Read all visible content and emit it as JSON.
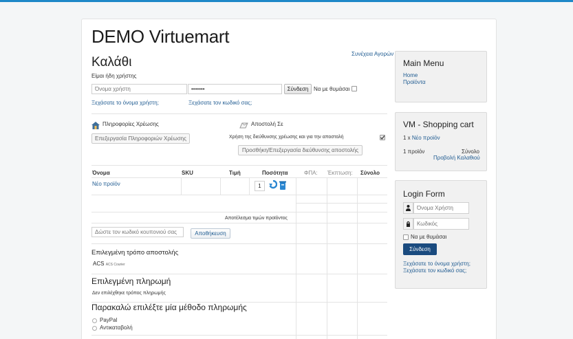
{
  "site": {
    "title": "DEMO Virtuemart"
  },
  "cart": {
    "heading": "Καλάθι",
    "continue_link": "Συνέχεια Αγορών",
    "already_user": "Είμαι ήδη χρήστης",
    "username_placeholder": "Όνομα χρήστη",
    "password_value": "•••••••",
    "login_button": "Σύνδεση",
    "remember_label": "Να με θυμάσαι",
    "forgot_username": "Ξεχάσατε το όνομα χρήστη;",
    "forgot_password": "Ξεχάσατε τον κωδικό σας;",
    "billing_title": "Πληροφορίες Χρέωσης",
    "billing_edit_button": "Επεξεργασία Πληροφοριών Χρέωσης",
    "shipping_title": "Αποστολή Σε",
    "use_billing_for_shipping": "Χρήση της διεύθυνσης χρέωσης και για την αποστολή",
    "shipping_edit_button": "Προσθήκη/Επεξεργασία διεύθυνσης αποστολής",
    "table": {
      "headers": [
        "Όνομα",
        "SKU",
        "Τιμή",
        "Ποσότητα",
        "ΦΠΑ:",
        "Έκπτωση:",
        "Σύνολο"
      ],
      "rows": [
        {
          "name": "Νέο προϊόν",
          "sku": "",
          "price": "",
          "quantity": "1",
          "tax": "",
          "discount": "",
          "total": ""
        }
      ],
      "products_result_label": "Αποτέλεσμα τιμών προϊόντος"
    },
    "coupon_placeholder": "Δώστε τον κωδικό κουπονιού σας",
    "coupon_save_button": "Αποθήκευση",
    "selected_shipment_title": "Επιλεγμένη τρόπο αποστολής",
    "shipment_name": "ACS",
    "shipment_desc": "ACS Courier",
    "selected_payment_title": "Επιλεγμένη πληρωμή",
    "no_payment_selected": "Δεν επιλέχθηκε τρόπος πληρωμής",
    "choose_payment_title": "Παρακαλώ επιλέξτε μία μέθοδο πληρωμής",
    "payment_options": [
      "PayPal",
      "Αντικαταβολή"
    ]
  },
  "main_menu": {
    "title": "Main Menu",
    "items": [
      "Home",
      "Προϊόντα"
    ]
  },
  "shopping_cart": {
    "title": "VM - Shopping cart",
    "count_prefix": "1 x ",
    "product_link": "Νέο προϊόν",
    "items_count": "1 προϊόν",
    "total_label": "Σύνολο",
    "view_cart": "Προβολή Καλαθιού"
  },
  "login_form": {
    "title": "Login Form",
    "username_placeholder": "Όνομα Χρήστη",
    "password_placeholder": "Κωδικός",
    "remember_label": "Να με θυμάσαι",
    "login_button": "Σύνδεση",
    "forgot_username": "Ξεχάσατε το όνομα χρήστη;",
    "forgot_password": "Ξεχάσατε τον κωδικό σας;"
  },
  "colors": {
    "accent": "#1e88c8",
    "link": "#1f5b91",
    "login_button": "#1a4b7f"
  }
}
